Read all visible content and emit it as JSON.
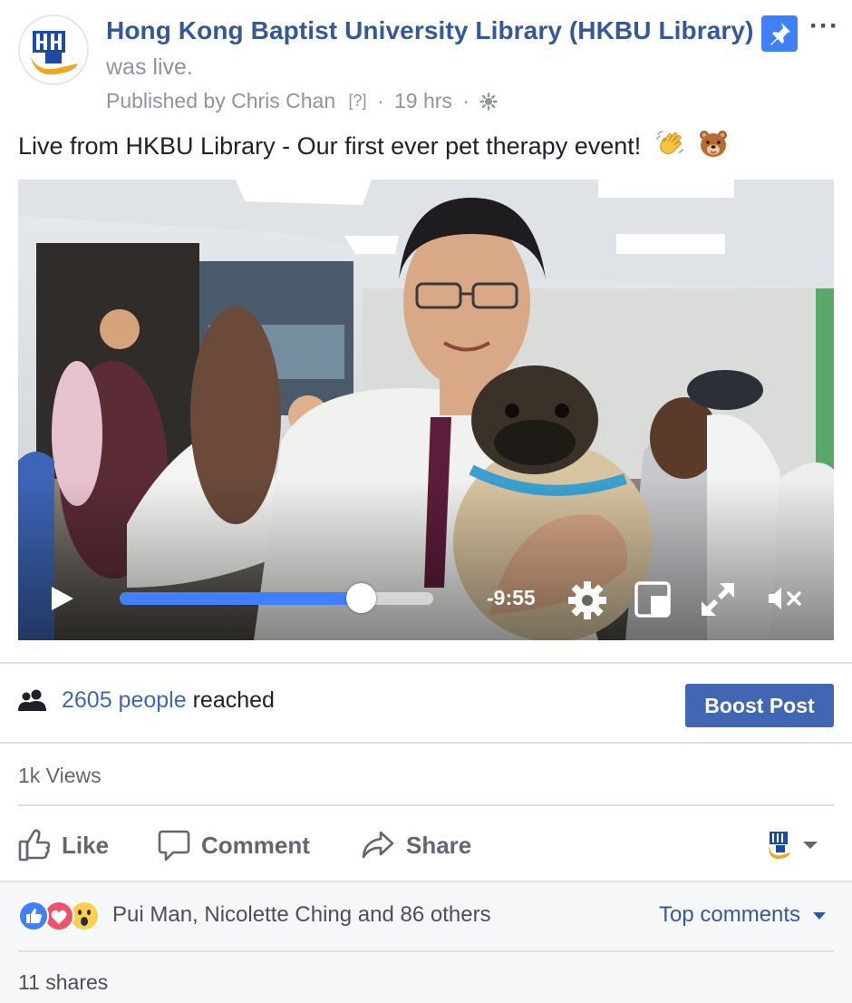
{
  "post": {
    "page_name": "Hong Kong Baptist University Library (HKBU Library)",
    "status": "was live.",
    "published_prefix": "Published by",
    "author": "Chris Chan",
    "author_badge": "[?]",
    "separator": "·",
    "time_ago": "19 hrs",
    "text": "Live from HKBU Library - Our first ever pet therapy event!",
    "emojis": [
      "waving-hand-icon",
      "bear-face-icon"
    ]
  },
  "video": {
    "time_remaining": "-9:55",
    "progress": 0.77,
    "icons": [
      "play-icon",
      "settings-gear-icon",
      "picture-in-picture-icon",
      "fullscreen-icon",
      "mute-icon"
    ]
  },
  "insights": {
    "reach_count": "2605 people",
    "reach_suffix": " reached",
    "boost_label": "Boost Post"
  },
  "views": "1k Views",
  "actions": {
    "like": "Like",
    "comment": "Comment",
    "share": "Share"
  },
  "engagement": {
    "reaction_names": "Pui Man, Nicolette Ching and 86 others",
    "reactions": [
      "like",
      "love",
      "wow"
    ],
    "sort_label": "Top comments",
    "shares": "11 shares"
  },
  "colors": {
    "link_blue": "#365899",
    "button_blue": "#4267b2",
    "progress_blue": "#4080ff",
    "muted_text": "#90949c",
    "divider": "#dddfe2"
  }
}
